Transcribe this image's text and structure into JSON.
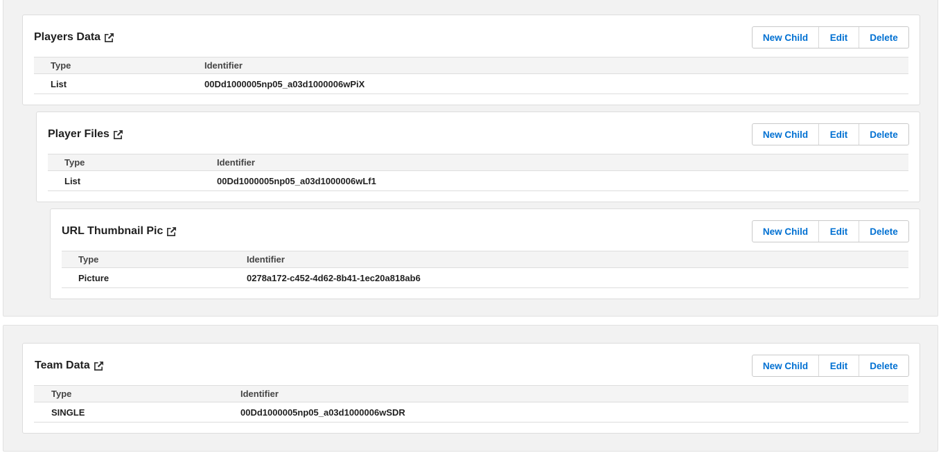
{
  "buttons": {
    "new_child": "New Child",
    "edit": "Edit",
    "delete": "Delete"
  },
  "table_headers": {
    "type": "Type",
    "identifier": "Identifier"
  },
  "groups": [
    {
      "cards": [
        {
          "title": "Players Data",
          "type": "List",
          "identifier": "00Dd1000005np05_a03d1000006wPiX"
        },
        {
          "title": "Player Files",
          "type": "List",
          "identifier": "00Dd1000005np05_a03d1000006wLf1"
        },
        {
          "title": "URL Thumbnail Pic",
          "type": "Picture",
          "identifier": "0278a172-c452-4d62-8b41-1ec20a818ab6"
        }
      ]
    },
    {
      "cards": [
        {
          "title": "Team Data",
          "type": "SINGLE",
          "identifier": "00Dd1000005np05_a03d1000006wSDR"
        }
      ]
    }
  ],
  "colors": {
    "link_blue": "#0070d2",
    "group_bg": "#f2f2f2",
    "header_bg": "#f4f4f4"
  }
}
